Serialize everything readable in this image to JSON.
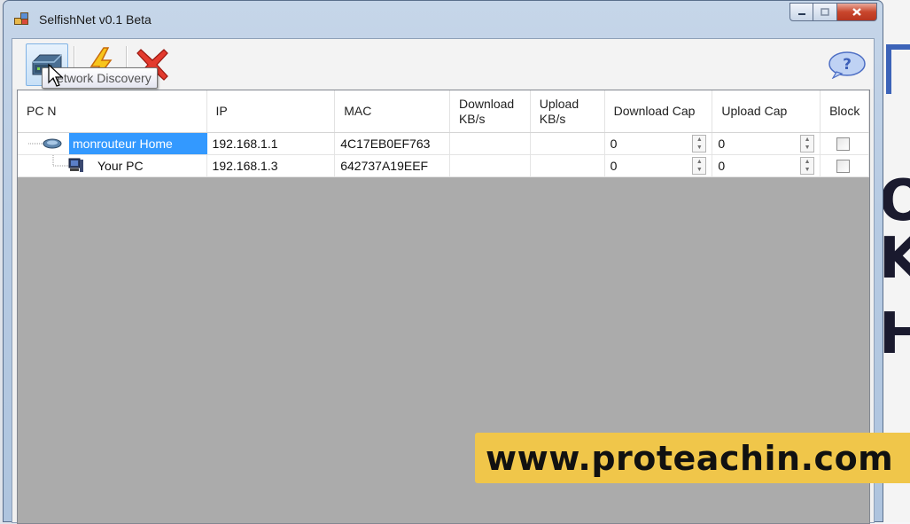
{
  "window": {
    "title": "SelfishNet v0.1 Beta"
  },
  "toolbar": {
    "tooltip": "Network Discovery",
    "buttons": [
      "network-discovery",
      "start",
      "stop"
    ]
  },
  "table": {
    "columns": [
      "PC N",
      "IP",
      "MAC",
      "Download KB/s",
      "Upload KB/s",
      "Download Cap",
      "Upload Cap",
      "Block"
    ],
    "rows": [
      {
        "name": "monrouteur Home",
        "ip": "192.168.1.1",
        "mac": "4C17EB0EF763",
        "download": "",
        "upload": "",
        "download_cap": "0",
        "upload_cap": "0",
        "block": false
      },
      {
        "name": "Your PC",
        "ip": "192.168.1.3",
        "mac": "642737A19EEF",
        "download": "",
        "upload": "",
        "download_cap": "0",
        "upload_cap": "0",
        "block": false
      }
    ]
  },
  "watermark": "www.proteachin.com",
  "colors": {
    "selection": "#3399ff",
    "close": "#c9462c",
    "watermark_bg": "#f0c64a"
  }
}
